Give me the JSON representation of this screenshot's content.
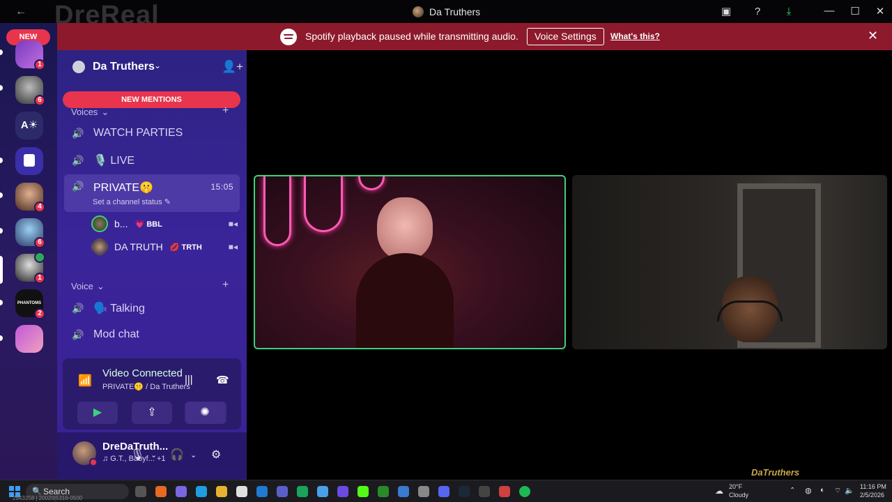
{
  "window": {
    "title": "Da Truthers",
    "watermark_logo": "DreReal_"
  },
  "banner": {
    "message": "Spotify playback paused while transmitting audio.",
    "voice_settings_label": "Voice Settings",
    "whats_this_label": "What's this?"
  },
  "rail": {
    "new_label": "NEW",
    "servers": [
      {
        "badge": "1"
      },
      {
        "badge": "6"
      },
      {
        "text": "A☀"
      },
      {},
      {
        "badge": "4"
      },
      {
        "badge": "6"
      },
      {
        "badge": "1"
      },
      {
        "badge": "2",
        "text": "PHANTOMS"
      },
      {}
    ]
  },
  "server": {
    "name": "Da Truthers",
    "new_mentions_label": "NEW MENTIONS"
  },
  "categories": {
    "voices": "Voices",
    "voice": "Voice"
  },
  "channels": {
    "watch_parties": "WATCH PARTIES",
    "live": "🎙️ LIVE",
    "private": "PRIVATE🤫",
    "private_time": "15:05",
    "private_status": "Set a channel status",
    "talking": "🗣️ Talking",
    "mod_chat": "Mod chat"
  },
  "voice_users": [
    {
      "name": "b...",
      "tag": "💗 BBL"
    },
    {
      "name": "DA TRUTH",
      "tag": "💋 TRTH"
    }
  ],
  "voice_panel": {
    "status": "Video Connected",
    "location": "PRIVATE🤫 / Da Truthers"
  },
  "user": {
    "name": "DreDaTruth...",
    "activity": "♫ G.T., Babyf... +1"
  },
  "stream_watermark": "DaTruthers",
  "taskbar": {
    "search_label": "Search",
    "fine_print": "2943358 | 20020|5316-0500",
    "weather_temp": "20°F",
    "weather_desc": "Cloudy",
    "time": "11:16 PM",
    "date": "2/5/2026"
  },
  "colors": {
    "banner_red": "#8d1a2c",
    "accent_red": "#e8344d",
    "voice_green": "#3bd37a",
    "sidebar_purple": "#3a2499"
  }
}
